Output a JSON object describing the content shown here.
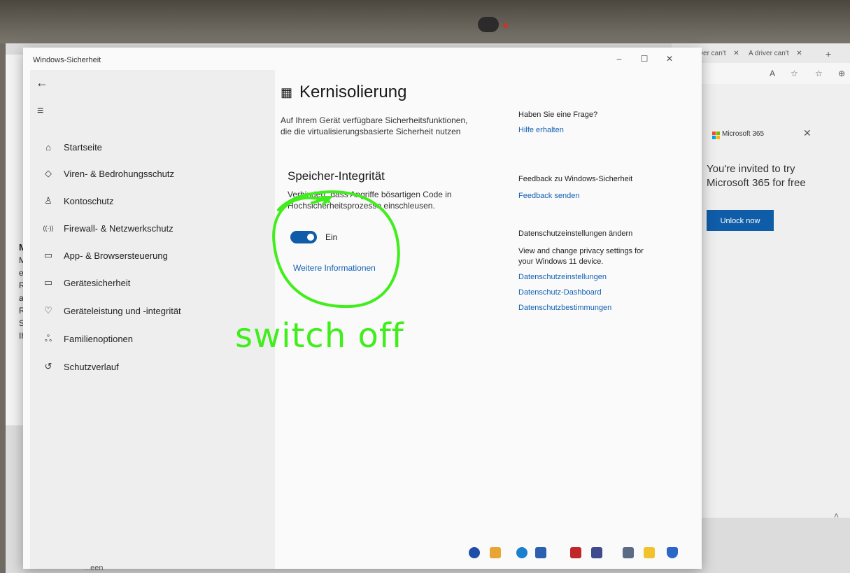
{
  "browser": {
    "tabs": [
      "A driver can't",
      "A driver can't"
    ],
    "tab_close": "✕",
    "new_tab": "+",
    "ms365": {
      "title": "Microsoft 365",
      "close": "✕",
      "invite_text": "You're invited to try Microsoft 365 for free",
      "button_label": "Unlock now"
    },
    "left_fragment_heading": "Mit",
    "left_fragment_lines": [
      "Mit",
      "einf",
      "Reg",
      "anzı",
      "Reg",
      "Sie",
      "Ihre"
    ]
  },
  "window": {
    "title": "Windows-Sicherheit",
    "minimize": "–",
    "maximize": "☐",
    "close": "✕"
  },
  "nav": {
    "back": "←",
    "menu": "≡",
    "items": [
      {
        "icon": "⌂",
        "label": "Startseite"
      },
      {
        "icon": "◇",
        "label": "Viren- & Bedrohungsschutz"
      },
      {
        "icon": "♙",
        "label": "Kontoschutz"
      },
      {
        "icon": "((·))",
        "label": "Firewall- & Netzwerkschutz"
      },
      {
        "icon": "▭",
        "label": "App- & Browsersteuerung"
      },
      {
        "icon": "▭",
        "label": "Gerätesicherheit"
      },
      {
        "icon": "♡",
        "label": "Geräteleistung und -integrität"
      },
      {
        "icon": "ஃ",
        "label": "Familienoptionen"
      },
      {
        "icon": "↺",
        "label": "Schutzverlauf"
      }
    ]
  },
  "main": {
    "title": "Kernisolierung",
    "subtitle": "Auf Ihrem Gerät verfügbare Sicherheitsfunktionen, die die virtualisierungsbasierte Sicherheit nutzen",
    "section_title": "Speicher-Integrität",
    "section_desc": "Verhindert, dass Angriffe bösartigen Code in Hochsicherheitsprozesse einschleusen.",
    "toggle_state": "Ein",
    "toggle_on": true,
    "more_info": "Weitere Informationen"
  },
  "side_panel": {
    "question_heading": "Haben Sie eine Frage?",
    "help_link": "Hilfe erhalten",
    "feedback_heading": "Feedback zu Windows-Sicherheit",
    "feedback_link": "Feedback senden",
    "privacy_heading": "Datenschutzeinstellungen ändern",
    "privacy_text": "View and change privacy settings for your Windows 11 device.",
    "privacy_links": [
      "Datenschutzeinstellungen",
      "Datenschutz-Dashboard",
      "Datenschutzbestimmungen"
    ]
  },
  "annotation": {
    "text": "switch off",
    "color": "#3fee1a"
  },
  "bottom_fragment": "...een",
  "colors": {
    "accent": "#0f5ca8",
    "link": "#1360b3",
    "annotation": "#3fee1a"
  }
}
